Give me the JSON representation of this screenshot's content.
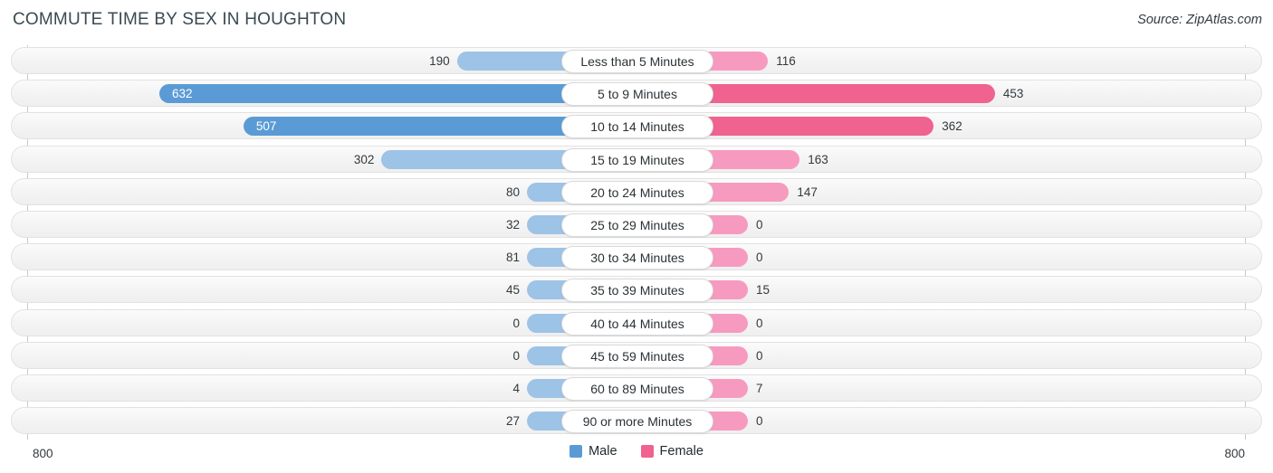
{
  "header": {
    "title": "COMMUTE TIME BY SEX IN HOUGHTON",
    "source": "Source: ZipAtlas.com"
  },
  "legend": {
    "items": [
      {
        "label": "Male",
        "color": "#5b9bd5",
        "name": "legend-male"
      },
      {
        "label": "Female",
        "color": "#f0628f",
        "name": "legend-female"
      }
    ]
  },
  "axis": {
    "left_tick": "800",
    "right_tick": "800",
    "max": 800
  },
  "chart_data": {
    "type": "bar",
    "title": "COMMUTE TIME BY SEX IN HOUGHTON",
    "subtitle": "Source: ZipAtlas.com",
    "orientation": "horizontal-diverging",
    "xlabel": "",
    "ylabel": "",
    "xlim": [
      800,
      800
    ],
    "grid": false,
    "legend_position": "bottom-center",
    "categories": [
      "Less than 5 Minutes",
      "5 to 9 Minutes",
      "10 to 14 Minutes",
      "15 to 19 Minutes",
      "20 to 24 Minutes",
      "25 to 29 Minutes",
      "30 to 34 Minutes",
      "35 to 39 Minutes",
      "40 to 44 Minutes",
      "45 to 59 Minutes",
      "60 to 89 Minutes",
      "90 or more Minutes"
    ],
    "series": [
      {
        "name": "Male",
        "color": "#5b9bd5",
        "values": [
          190,
          632,
          507,
          302,
          80,
          32,
          81,
          45,
          0,
          0,
          4,
          27
        ]
      },
      {
        "name": "Female",
        "color": "#f0628f",
        "values": [
          116,
          453,
          362,
          163,
          147,
          0,
          0,
          15,
          0,
          0,
          7,
          0
        ]
      }
    ]
  },
  "rows": [
    {
      "label": "Less than 5 Minutes",
      "male": "190",
      "female": "116"
    },
    {
      "label": "5 to 9 Minutes",
      "male": "632",
      "female": "453"
    },
    {
      "label": "10 to 14 Minutes",
      "male": "507",
      "female": "362"
    },
    {
      "label": "15 to 19 Minutes",
      "male": "302",
      "female": "163"
    },
    {
      "label": "20 to 24 Minutes",
      "male": "80",
      "female": "147"
    },
    {
      "label": "25 to 29 Minutes",
      "male": "32",
      "female": "0"
    },
    {
      "label": "30 to 34 Minutes",
      "male": "81",
      "female": "0"
    },
    {
      "label": "35 to 39 Minutes",
      "male": "45",
      "female": "15"
    },
    {
      "label": "40 to 44 Minutes",
      "male": "0",
      "female": "0"
    },
    {
      "label": "45 to 59 Minutes",
      "male": "0",
      "female": "0"
    },
    {
      "label": "60 to 89 Minutes",
      "male": "4",
      "female": "7"
    },
    {
      "label": "90 or more Minutes",
      "male": "27",
      "female": "0"
    }
  ]
}
